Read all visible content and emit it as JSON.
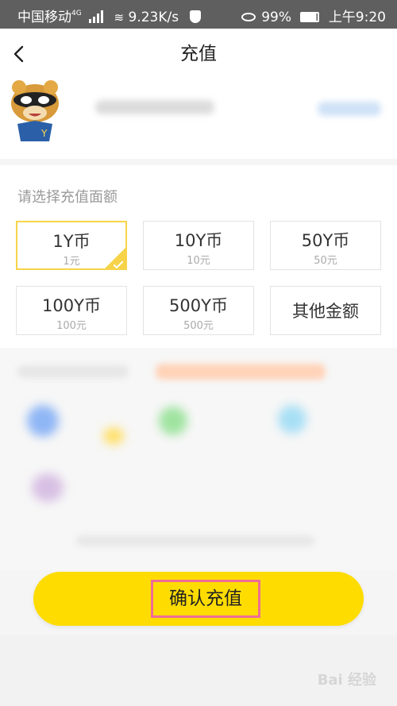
{
  "status_bar": {
    "carrier": "中国移动",
    "network": "4G",
    "speed": "9.23K/s",
    "battery": "99%",
    "time": "上午9:20",
    "icons": [
      "signal-icon",
      "wifi-icon",
      "shield-icon",
      "eye-icon",
      "battery-icon"
    ]
  },
  "header": {
    "back_icon": "chevron-left-icon",
    "title": "充值"
  },
  "recharge": {
    "prompt": "请选择充值面额",
    "options": [
      {
        "amount": "1Y币",
        "price": "1元",
        "selected": true
      },
      {
        "amount": "10Y币",
        "price": "10元",
        "selected": false
      },
      {
        "amount": "50Y币",
        "price": "50元",
        "selected": false
      },
      {
        "amount": "100Y币",
        "price": "100元",
        "selected": false
      },
      {
        "amount": "500Y币",
        "price": "500元",
        "selected": false
      },
      {
        "amount": "其他金额",
        "selected": false
      }
    ]
  },
  "confirm": {
    "label": "确认充值"
  },
  "watermark": {
    "text": "Bai 经验"
  },
  "colors": {
    "accent_yellow": "#ffdc00",
    "selected_border": "#f7d34a",
    "highlight_box": "#ef6c96",
    "status_bar": "#5f5f5f"
  }
}
